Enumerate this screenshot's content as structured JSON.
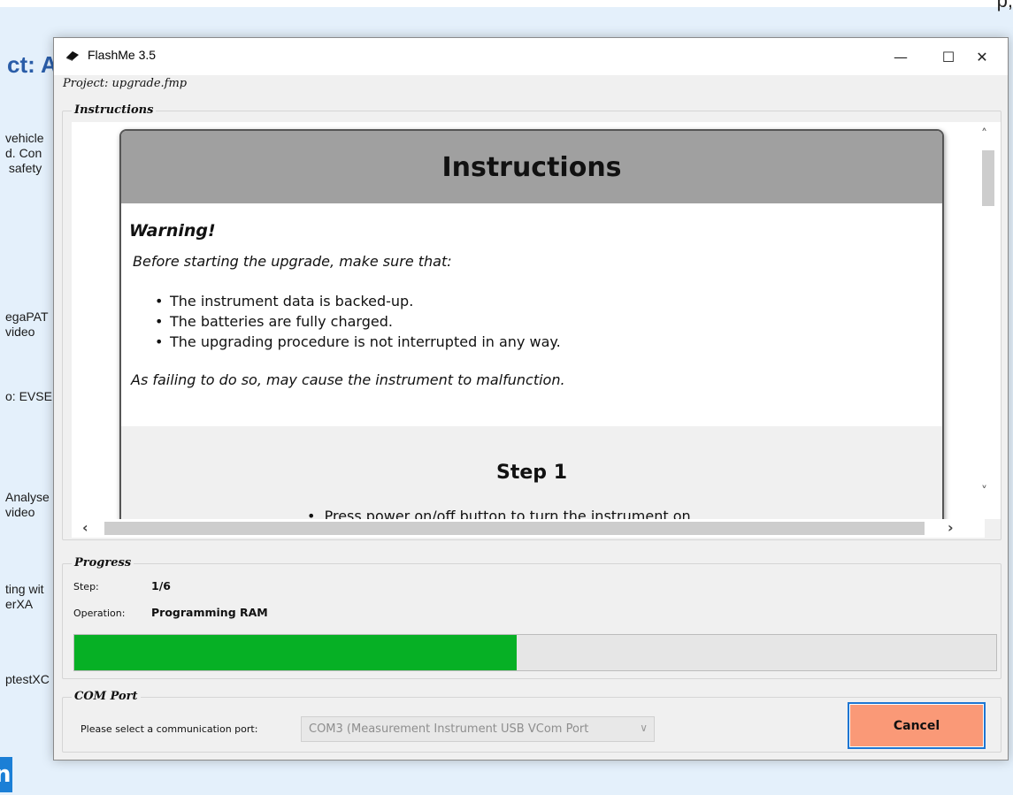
{
  "background_page": {
    "title_fragment": "ct: A",
    "top_right_fragment": "p,",
    "snippets": [
      "vehicle\nd. Con\n safety",
      "egaPAT\nvideo",
      "o: EVSE",
      "Analyse\nvideo",
      "ting wit\nerXA",
      "ptestXC"
    ],
    "logo_letter": "n"
  },
  "window": {
    "title": "FlashMe 3.5",
    "app_icon": "chip-icon",
    "controls": {
      "minimize": "—",
      "maximize": "☐",
      "close": "✕"
    }
  },
  "project_label": "Project: upgrade.fmp",
  "instructions_group": {
    "legend": "Instructions",
    "card": {
      "header": "Instructions",
      "warning": "Warning!",
      "intro": "Before starting the upgrade, make sure that:",
      "items": [
        "The instrument data is backed-up.",
        "The batteries are fully charged.",
        "The upgrading procedure is not interrupted in any way."
      ],
      "footer": "As failing to do so, may cause the instrument to malfunction.",
      "step_title": "Step 1",
      "step_first_item": "Press power on/off button to turn the instrument on"
    },
    "scroll": {
      "up": "^",
      "down": "v",
      "left": "<",
      "right": ">"
    }
  },
  "progress_group": {
    "legend": "Progress",
    "step_label": "Step:",
    "step_value": "1/6",
    "operation_label": "Operation:",
    "operation_value": "Programming RAM",
    "percent": 48,
    "bar_color": "#06b025"
  },
  "com_group": {
    "legend": "COM Port",
    "prompt": "Please select a communication port:",
    "selected": "COM3 (Measurement Instrument USB VCom Port",
    "cancel_label": "Cancel",
    "cancel_color": "#fa9977"
  }
}
